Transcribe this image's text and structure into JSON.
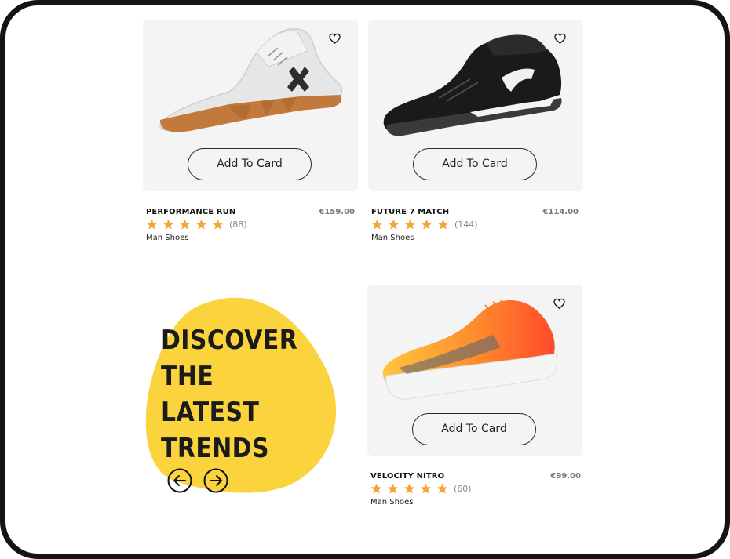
{
  "products": [
    {
      "name": "PERFORMANCE RUN",
      "price": "€159.00",
      "rating": 5,
      "reviews": "(88)",
      "category": "Man Shoes",
      "button_label": "Add To Card",
      "image_icon": "white-gum-sole-sneaker",
      "accent": "#c27a3c"
    },
    {
      "name": "FUTURE 7 MATCH",
      "price": "€114.00",
      "rating": 5,
      "reviews": "(144)",
      "category": "Man Shoes",
      "button_label": "Add To Card",
      "image_icon": "black-football-boot",
      "accent": "#141414"
    },
    {
      "name": "VELOCITY NITRO",
      "price": "€99.00",
      "rating": 5,
      "reviews": "(60)",
      "category": "Man Shoes",
      "button_label": "Add To Card",
      "image_icon": "orange-running-shoe",
      "accent": "#ff5a2a"
    }
  ],
  "promo": {
    "lines": [
      "DISCOVER",
      "THE",
      "LATEST",
      "TRENDS"
    ],
    "prev_icon": "arrow-left-circle-icon",
    "next_icon": "arrow-right-circle-icon",
    "blob_color": "#fbd33d"
  },
  "colors": {
    "star": "#f7a532",
    "card_bg": "#f4f4f4",
    "device_frame": "#141414"
  }
}
